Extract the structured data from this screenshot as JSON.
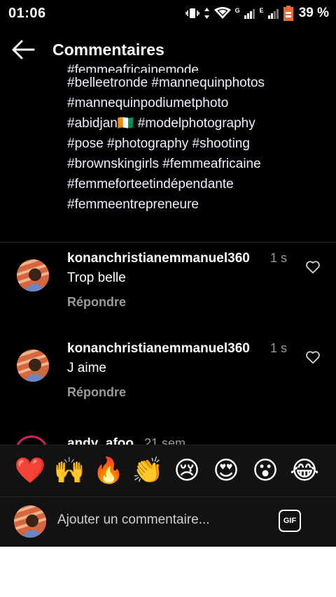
{
  "status_bar": {
    "time": "01:06",
    "battery": "39 %",
    "signal_labels": [
      "G",
      "E"
    ]
  },
  "header": {
    "title": "Commentaires",
    "back_icon": "arrow-left-icon"
  },
  "caption": {
    "clipped_line": "#femmeafricainemode",
    "lines": [
      "#belleetronde #mannequinphotos",
      "#mannequinpodiumetphoto",
      "#abidjan🇨🇮 #modelphotography",
      "#pose #photography #shooting",
      "#brownskingirls #femmeafricaine",
      "#femmeforteetindépendante",
      "#femmeentrepreneure"
    ]
  },
  "comments": [
    {
      "user": "konanchristianemmanuel360",
      "time": "1 s",
      "text": "Trop belle",
      "reply": "Répondre"
    },
    {
      "user": "konanchristianemmanuel360",
      "time": "1 s",
      "text": "J aime",
      "reply": "Répondre"
    }
  ],
  "partial_comment": {
    "user": "andy_afoo",
    "time": "21 sem"
  },
  "emoji_bar": {
    "emojis": [
      "❤️",
      "🙌",
      "🔥",
      "👏",
      "😢",
      "😍",
      "😮",
      "😂"
    ]
  },
  "comment_input": {
    "placeholder": "Ajouter un commentaire...",
    "gif_label": "GIF"
  },
  "colors": {
    "background": "#000000",
    "secondary_text": "#9a9a9a",
    "story_ring": "#d0206a"
  }
}
